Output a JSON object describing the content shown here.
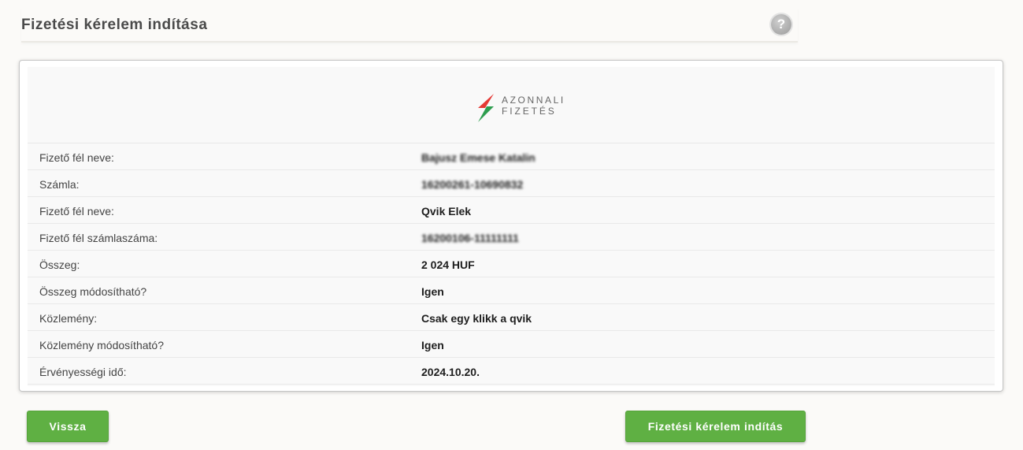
{
  "header": {
    "title": "Fizetési kérelem indítása",
    "help_icon": "question-circle-icon"
  },
  "logo": {
    "line1": "AZONNALI",
    "line2": "FIZETÉS",
    "colors": {
      "red": "#e53935",
      "green": "#2e9e4f"
    }
  },
  "details": [
    {
      "label": "Fizető fél neve:",
      "value": "Bajusz Emese Katalin",
      "masked": true
    },
    {
      "label": "Számla:",
      "value": "16200261-10690832",
      "masked": true
    },
    {
      "label": "Fizető fél neve:",
      "value": "Qvik Elek",
      "masked": false
    },
    {
      "label": "Fizető fél számlaszáma:",
      "value": "16200106-11111111",
      "masked": true
    },
    {
      "label": "Összeg:",
      "value": "2 024 HUF",
      "masked": false
    },
    {
      "label": "Összeg módosítható?",
      "value": "Igen",
      "masked": false
    },
    {
      "label": "Közlemény:",
      "value": "Csak egy klikk a qvik",
      "masked": false
    },
    {
      "label": "Közlemény módosítható?",
      "value": "Igen",
      "masked": false
    },
    {
      "label": "Érvényességi idő:",
      "value": "2024.10.20.",
      "masked": false
    }
  ],
  "buttons": {
    "back": "Vissza",
    "start": "Fizetési kérelem indítás"
  },
  "colors": {
    "button": "#5fb043",
    "background": "#fbfaf8"
  }
}
